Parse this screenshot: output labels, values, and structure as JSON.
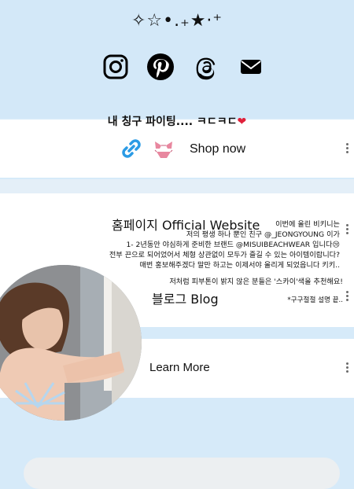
{
  "decor": {
    "sparkles": "✧☆•.₊★·⁺"
  },
  "socials": [
    {
      "name": "instagram-icon",
      "color": "#000000"
    },
    {
      "name": "pinterest-icon",
      "color": "#000000"
    },
    {
      "name": "threads-icon",
      "color": "#000000"
    },
    {
      "name": "mail-icon",
      "color": "#000000"
    }
  ],
  "story": {
    "caption": "내 칭구 파이팅.... ㅋㄷㅋㄷ",
    "heart": "❤",
    "overlay_main": [
      "이번에 올린 비키니는",
      "저의 평생 하나 뿐인 친구 @_JEONGYOUNG 이가",
      "1- 2년동안 야심하게 준비한 브랜드 @MISUIBEACHWEAR 입니다😢",
      "전부 끈으로 되어었어서 체형 상관없이 모두가 즐길 수 있는 아이템이랍니다?",
      "매번 홍보해주겠다 말만 하고는 이제서야 올리게 되었읍니다 키키.."
    ],
    "overlay_rec": "저처럼 피부톤이 밝지 않은 분들은 '스카이'색을 추천해요!",
    "overlay_note": "*구구절절 설명 끝.."
  },
  "links": {
    "shop": "Shop now",
    "homepage": "홈페이지 Official Website",
    "blog": "블로그 Blog",
    "learn": "Learn More"
  },
  "colors": {
    "background": "#d6eaf9",
    "card": "#ffffff",
    "link_icon": "#2b9be5",
    "bikini": "#e8879f"
  }
}
